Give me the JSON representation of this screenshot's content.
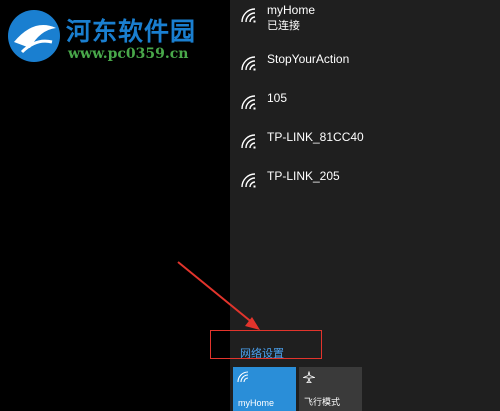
{
  "watermark": {
    "title": "河东软件园",
    "url": "www.pc0359.cn"
  },
  "networks": [
    {
      "name": "myHome",
      "status": "已连接"
    },
    {
      "name": "StopYourAction"
    },
    {
      "name": "105"
    },
    {
      "name": "TP-LINK_81CC40"
    },
    {
      "name": "TP-LINK_205"
    }
  ],
  "settings_link": "网络设置",
  "quick_actions": [
    {
      "label": "myHome",
      "icon": "wifi-icon",
      "active": true
    },
    {
      "label": "飞行模式",
      "icon": "airplane-icon",
      "active": false
    }
  ],
  "colors": {
    "panel_bg": "#1f1f1f",
    "accent": "#2a8ed8",
    "link": "#4ba3f2",
    "highlight": "#e2342c"
  }
}
